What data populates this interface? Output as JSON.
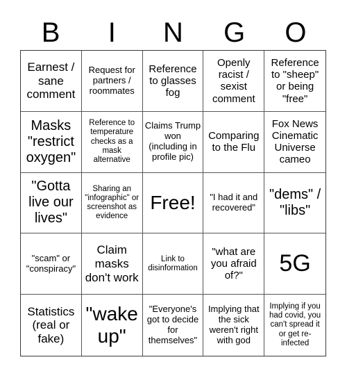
{
  "header": {
    "letters": [
      "B",
      "I",
      "N",
      "G",
      "O"
    ]
  },
  "cells": [
    {
      "text": "Earnest / sane comment",
      "size": "s-lg"
    },
    {
      "text": "Request for partners / roommates",
      "size": "s-sm"
    },
    {
      "text": "Reference to glasses fog",
      "size": "s-md"
    },
    {
      "text": "Openly racist / sexist comment",
      "size": "s-md"
    },
    {
      "text": "Reference to \"sheep\" or being \"free\"",
      "size": "s-md"
    },
    {
      "text": "Masks \"restrict oxygen\"",
      "size": "s-xl"
    },
    {
      "text": "Reference to temperature checks as a mask alternative",
      "size": "s-xs"
    },
    {
      "text": "Claims Trump won (including in profile pic)",
      "size": "s-sm"
    },
    {
      "text": "Comparing to the Flu",
      "size": "s-md"
    },
    {
      "text": "Fox News Cinematic Universe cameo",
      "size": "s-md"
    },
    {
      "text": "\"Gotta live our lives\"",
      "size": "s-xl"
    },
    {
      "text": "Sharing an \"infographic\" or screenshot as evidence",
      "size": "s-xs"
    },
    {
      "text": "Free!",
      "size": "s-xxl"
    },
    {
      "text": "\"I had it and recovered\"",
      "size": "s-sm"
    },
    {
      "text": "\"dems\" / \"libs\"",
      "size": "s-xl"
    },
    {
      "text": "\"scam\" or \"conspiracy\"",
      "size": "s-sm"
    },
    {
      "text": "Claim masks don't work",
      "size": "s-lg"
    },
    {
      "text": "Link to disinformation",
      "size": "s-xs"
    },
    {
      "text": "\"what are you afraid of?\"",
      "size": "s-md"
    },
    {
      "text": "5G",
      "size": "s-huge"
    },
    {
      "text": "Statistics (real or fake)",
      "size": "s-lg"
    },
    {
      "text": "\"wake up\"",
      "size": "s-xxl"
    },
    {
      "text": "\"Everyone's got to decide for themselves\"",
      "size": "s-sm"
    },
    {
      "text": "Implying that the sick weren't right with god",
      "size": "s-sm"
    },
    {
      "text": "Implying if you had covid, you can't spread it or get re-infected",
      "size": "s-xs"
    }
  ]
}
